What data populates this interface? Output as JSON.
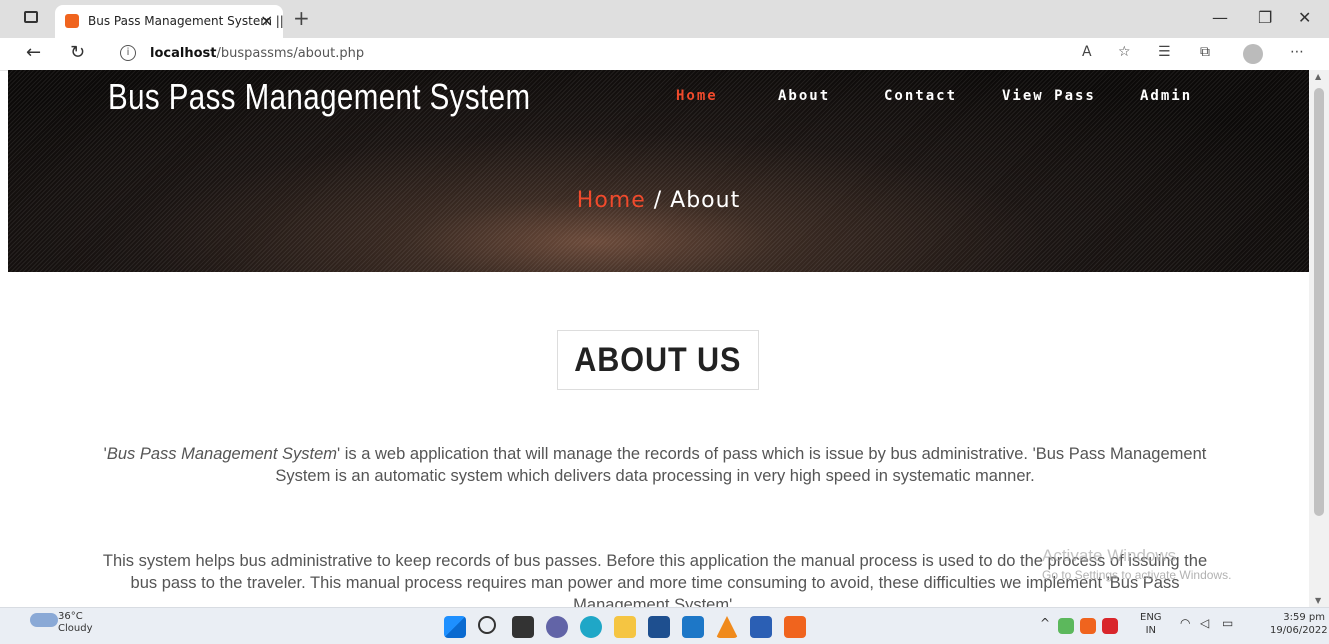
{
  "browser": {
    "tab_title": "Bus Pass Management System ||",
    "url_host": "localhost",
    "url_path": "/buspassms/about.php"
  },
  "site": {
    "brand": "Bus Pass Management System",
    "nav": [
      {
        "label": "Home",
        "active": true
      },
      {
        "label": "About",
        "active": false
      },
      {
        "label": "Contact",
        "active": false
      },
      {
        "label": "View Pass",
        "active": false
      },
      {
        "label": "Admin",
        "active": false
      }
    ],
    "breadcrumb": {
      "home": "Home",
      "sep": " / ",
      "current": "About"
    }
  },
  "content": {
    "heading": "ABOUT US",
    "para1_em": "Bus Pass Management System",
    "para1_rest": "' is a web application that will manage the records of pass which is issue by bus administrative. 'Bus Pass Management System is an automatic system which delivers data processing in very high speed in systematic manner.",
    "para2": "This system helps bus administrative to keep records of bus passes. Before this application the manual process is used to do the process of issuing the bus pass to the traveler. This manual process requires man power and more time consuming to avoid, these difficulties we implement 'Bus Pass Management System'."
  },
  "watermark": {
    "line1": "Activate Windows",
    "line2": "Go to Settings to activate Windows."
  },
  "taskbar": {
    "temp": "36°C",
    "weather": "Cloudy",
    "lang": "ENG",
    "region": "IN",
    "time": "3:59 pm",
    "date": "19/06/2022"
  },
  "colors": {
    "accent": "#f04a2c",
    "hero_bg": "#0c0a09"
  }
}
